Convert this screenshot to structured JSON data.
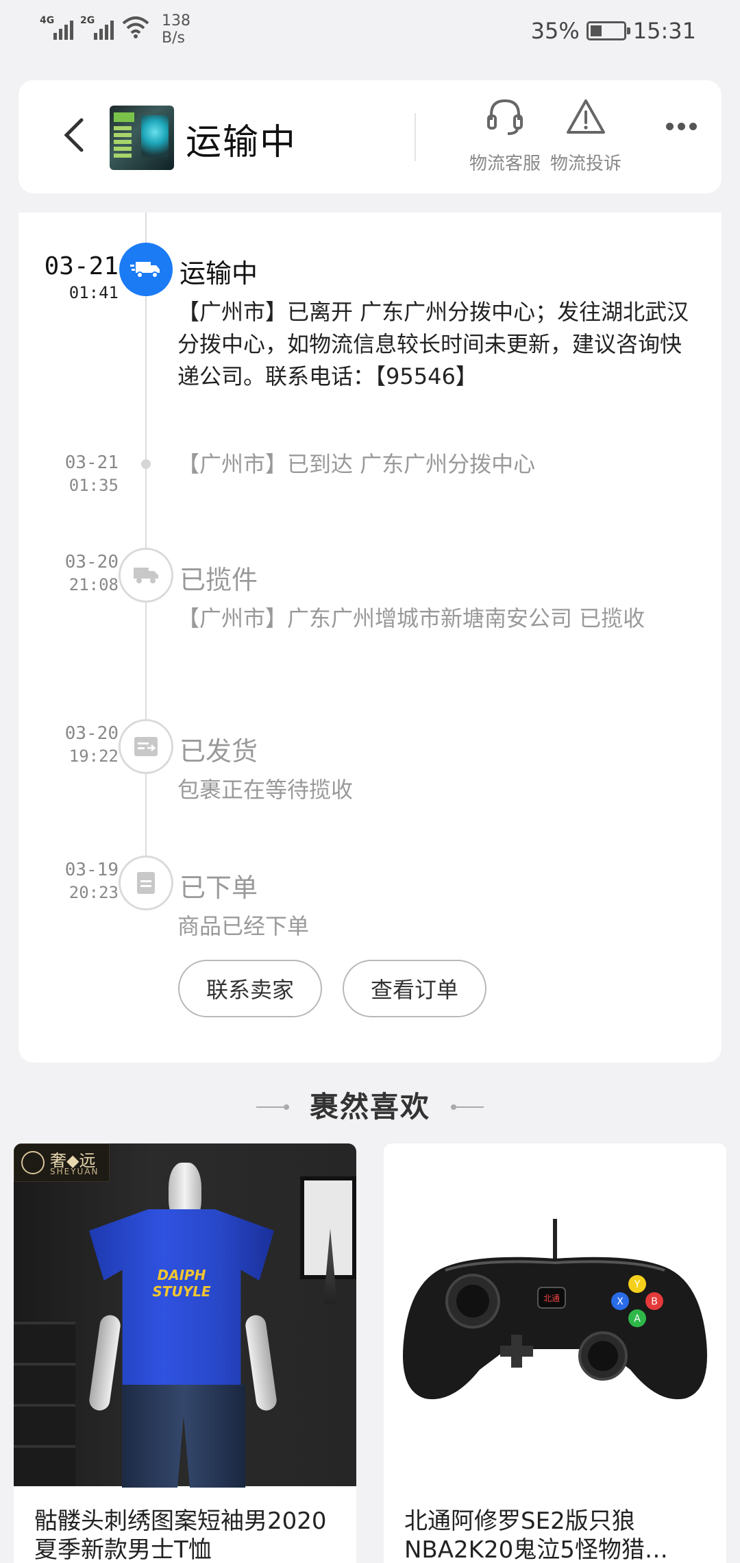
{
  "status_bar": {
    "network1": "4G",
    "network2": "2G",
    "speed_value": "138",
    "speed_unit": "B/s",
    "battery_text": "35%",
    "battery_level": 0.35,
    "time": "15:31"
  },
  "header": {
    "title": "运输中",
    "actions": [
      {
        "label": "物流客服",
        "icon": "headset-icon"
      },
      {
        "label": "物流投诉",
        "icon": "warning-icon"
      }
    ],
    "more_icon": "more-icon"
  },
  "timeline": [
    {
      "date": "03-21",
      "time": "01:41",
      "status": "运输中",
      "icon": "truck-icon",
      "desc": "【广州市】已离开 广东广州分拨中心；发往湖北武汉分拨中心，如物流信息较长时间未更新，建议咨询快递公司。联系电话：【95546】"
    },
    {
      "date": "03-21",
      "time": "01:35",
      "status": "",
      "icon": "dot",
      "desc": "【广州市】已到达 广东广州分拨中心"
    },
    {
      "date": "03-20",
      "time": "21:08",
      "status": "已揽件",
      "icon": "truck-icon",
      "desc": "【广州市】广东广州增城市新塘南安公司 已揽收"
    },
    {
      "date": "03-20",
      "time": "19:22",
      "status": "已发货",
      "icon": "ship-icon",
      "desc": "包裹正在等待揽收"
    },
    {
      "date": "03-19",
      "time": "20:23",
      "status": "已下单",
      "icon": "order-icon",
      "desc": "商品已经下单"
    }
  ],
  "buttons": {
    "contact_seller": "联系卖家",
    "view_order": "查看订单"
  },
  "recommend": {
    "title": "裹然喜欢",
    "products": [
      {
        "title": "骷髅头刺绣图案短袖男2020夏季新款男士T恤",
        "brand": "奢◆远",
        "brand_sub": "SHEYUAN",
        "print": "DAIPH STUYLE"
      },
      {
        "title": "北通阿修罗SE2版只狼NBA2K20鬼泣5怪物猎…",
        "pad_label": "北通"
      }
    ]
  },
  "colors": {
    "accent": "#1a7bf5",
    "background": "#f2f2f4"
  }
}
